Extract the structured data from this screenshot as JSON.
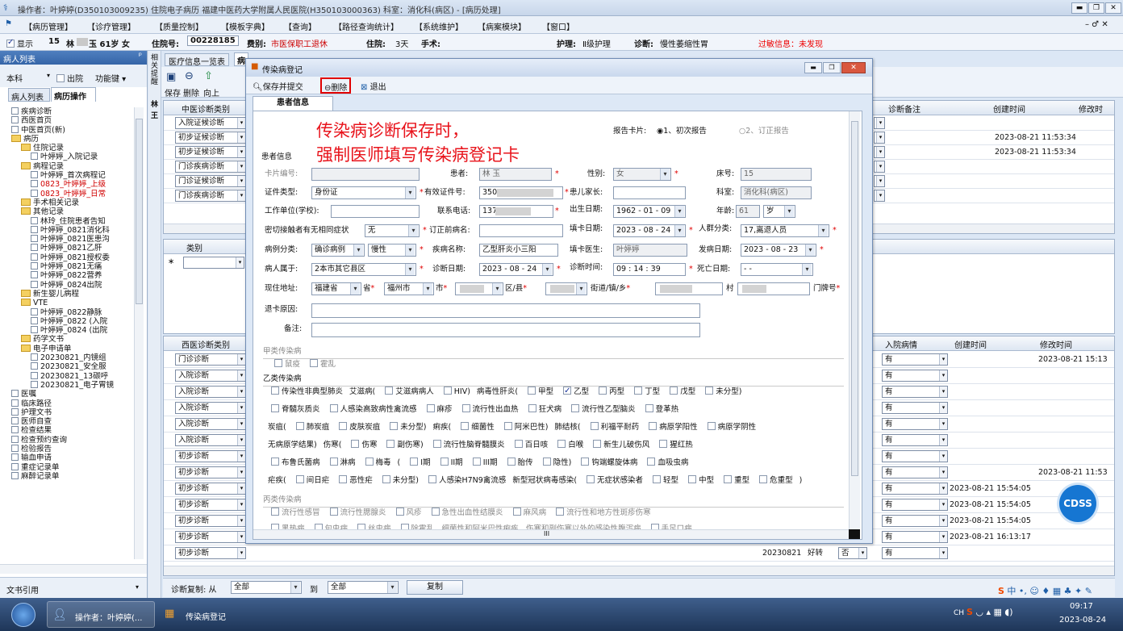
{
  "titlebar": {
    "text": "操作者：叶婷婷(D350103009235) 住院电子病历  福建中医药大学附属人民医院(H350103000363)  科室：消化科(病区) - [病历处理]"
  },
  "menu": [
    "【病历管理】",
    "【诊疗管理】",
    "【质量控制】",
    "【模板字典】",
    "【查询】",
    "【路径查询统计】",
    "【系统维护】",
    "【病案模块】",
    "【窗口】"
  ],
  "patient_bar": {
    "show": "显示",
    "bed": "15",
    "name": "林",
    "name2": "玉 61岁 女",
    "inpatient_no_label": "住院号:",
    "inpatient_no": "00228185",
    "category_label": "费别:",
    "category": "市医保职工退休",
    "days_label": "住院:",
    "days": "3天",
    "surgery_label": "手术:",
    "nursing_label": "护理:",
    "nursing": "Ⅱ级护理",
    "diagnosis_label": "诊断:",
    "diagnosis": "慢性萎缩性胃",
    "allergy": "过敏信息：未发现"
  },
  "left": {
    "header": "病人列表",
    "pin": "ᵖ",
    "dept": "本科",
    "discharged": "出院",
    "func": "功能键",
    "tab1": "病人列表",
    "tab2": "病历操作",
    "tree": [
      "疾病诊断",
      "西医首页",
      "中医首页(新)",
      "病历",
      "住院记录",
      "叶婷婷_入院记录",
      "病程记录",
      "叶婷婷_首次病程记",
      "0823_叶婷婷_上级",
      "0823_叶婷婷_日常",
      "手术相关记录",
      "其他记录",
      "林玲_住院患者告知",
      "叶婷婷_0821消化科",
      "叶婷婷_0821医患沟",
      "叶婷婷_0821乙肝",
      "叶婷婷_0821授权委",
      "叶婷婷_0821无痛",
      "叶婷婷_0822营养",
      "叶婷婷_0824出院",
      "新生婴儿病程",
      "VTE",
      "叶婷婷_0822静脉",
      "叶婷婷_0822 (入院",
      "叶婷婷_0824 (出院",
      "药学文书",
      "电子申请单",
      "20230821_内镜组",
      "20230821_安全服",
      "20230821_13碳呼",
      "20230821_电子胃镜",
      "医嘱",
      "临床路径",
      "护理文书",
      "医师自查",
      "检查结果",
      "检查预约查询",
      "检验报告",
      "输血申请",
      "重症记录单",
      "麻醉记录单"
    ],
    "bottom": "文书引用"
  },
  "side_strip": [
    "相关提醒",
    "林",
    "王"
  ],
  "tabs": {
    "t1": "医疗信息一览表",
    "t2": "病"
  },
  "toolbar": {
    "save": "保存",
    "delete": "删除",
    "up": "向上"
  },
  "upper_grid": {
    "col1": "中医诊断类别",
    "rows": [
      "入院证候诊断",
      "初步证候诊断",
      "初步证候诊断",
      "门诊疾病诊断",
      "门诊证候诊断",
      "门诊疾病诊断"
    ],
    "right_cols": [
      "诊断备注",
      "创建时间",
      "修改时"
    ],
    "times": [
      "",
      "2023-08-21 11:53:34",
      "2023-08-21 11:53:34",
      "",
      "",
      ""
    ]
  },
  "mid_grid": {
    "col": "类别",
    "star": "∗"
  },
  "lower_grid": {
    "col1": "西医诊断类别",
    "rows": [
      "门诊诊断",
      "入院诊断",
      "入院诊断",
      "入院诊断",
      "入院诊断",
      "入院诊断",
      "初步诊断",
      "初步诊断",
      "初步诊断",
      "初步诊断",
      "初步诊断",
      "初步诊断",
      "初步诊断"
    ],
    "right_cols": [
      "入院病情",
      "创建时间",
      "修改时间"
    ],
    "cond": "有",
    "created": [
      "",
      "",
      "",
      "",
      "",
      "",
      "",
      "",
      "2023-08-21 15:54:05",
      "2023-08-21 15:54:05",
      "2023-08-21 15:54:05",
      "2023-08-21 16:13:17",
      ""
    ],
    "modified": [
      "2023-08-21 15:13",
      "",
      "",
      "",
      "",
      "",
      "",
      "2023-08-21 11:53",
      "",
      "",
      "",
      "",
      ""
    ],
    "last_row": {
      "date": "20230821",
      "outcome": "好转",
      "flag": "否",
      "cond": "有"
    }
  },
  "bottom_bar": {
    "copy_label": "诊断复制: 从",
    "from": "全部",
    "to_label": "到",
    "to": "全部",
    "copy_btn": "复制"
  },
  "dialog": {
    "title": "传染病登记",
    "save_submit": "保存并提交",
    "delete": "删除",
    "exit": "退出",
    "tab": "患者信息",
    "annotation1": "传染病诊断保存时，",
    "annotation2": "强制医师填写传染病登记卡",
    "report_card_label": "报告卡片:",
    "report1": "1、初次报告",
    "report2": "2、订正报告",
    "section": "患者信息",
    "card_no_label": "卡片编号:",
    "patient_label": "患者:",
    "patient": "林  玉",
    "gender_label": "性别:",
    "gender": "女",
    "bed_label": "床号:",
    "bed": "15",
    "idtype_label": "证件类型:",
    "idtype": "身份证",
    "idno_label": "有效证件号:",
    "idno": "350",
    "guardian_label": "患儿家长:",
    "dept_label": "科室:",
    "dept": "消化科(病区)",
    "work_label": "工作单位(学校):",
    "phone_label": "联系电话:",
    "phone": "137",
    "dob_label": "出生日期:",
    "dob": "1962 - 01 - 09",
    "age_label": "年龄:",
    "age": "61",
    "age_unit": "岁",
    "contact_label": "密切接触者有无相同症状",
    "contact": "无",
    "prev_label": "订正前病名:",
    "fill_date_label": "填卡日期:",
    "fill_date": "2023 - 08 - 24",
    "crowd_label": "人群分类:",
    "crowd": "17,离退人员",
    "case_label": "病例分类:",
    "case1": "确诊病例",
    "case2": "慢性",
    "disease_label": "疾病名称:",
    "disease": "乙型肝炎小三阳",
    "doctor_label": "填卡医生:",
    "doctor": "叶婷婷",
    "onset_label": "发病日期:",
    "onset": "2023 - 08 - 23",
    "belong_label": "病人属于:",
    "belong": "2本市其它县区",
    "diag_date_label": "诊断日期:",
    "diag_date": "2023 - 08 - 24",
    "diag_time_label": "诊断时间:",
    "diag_time": "09 : 14 : 39",
    "death_label": "死亡日期:",
    "death": "-   -",
    "addr_label": "现住地址:",
    "province": "福建省",
    "province_s": "省",
    "city": "福州市",
    "city_s": "市",
    "district_s": "区/县",
    "street_s": "街道/镇/乡",
    "village_s": "村",
    "house_s": "门牌号",
    "return_label": "退卡原因:",
    "remark_label": "备注:",
    "classA": "甲类传染病",
    "classA_items": [
      "鼠疫",
      "霍乱"
    ],
    "classB": "乙类传染病",
    "b_line1": [
      "传染性非典型肺炎",
      "艾滋病(",
      "艾滋病病人",
      "HIV)",
      "病毒性肝炎(",
      "甲型",
      "乙型",
      "丙型",
      "丁型",
      "戊型",
      "未分型)"
    ],
    "b_line2": [
      "脊髓灰质炎",
      "人感染高致病性禽流感",
      "麻疹",
      "流行性出血热",
      "狂犬病",
      "流行性乙型脑炎",
      "登革热"
    ],
    "b_line3": [
      "炭疽(",
      "肺炭疽",
      "皮肤炭疽",
      "未分型)",
      "痢疾(",
      "细菌性",
      "阿米巴性)",
      "肺结核(",
      "利福平耐药",
      "病原学阳性",
      "病原学阴性"
    ],
    "b_line4": [
      "无病原学结果)",
      "伤寒(",
      "伤寒",
      "副伤寒)",
      "流行性脑脊髓膜炎",
      "百日咳",
      "白喉",
      "新生儿破伤风",
      "猩红热"
    ],
    "b_line5": [
      "布鲁氏菌病",
      "淋病",
      "梅毒",
      "(",
      "I期",
      "II期",
      "III期",
      "胎传",
      "隐性)",
      "钩端螺旋体病",
      "血吸虫病"
    ],
    "b_line6": [
      "疟疾(",
      "间日疟",
      "恶性疟",
      "未分型)",
      "人感染H7N9禽流感",
      "新型冠状病毒感染(",
      "无症状感染者",
      "轻型",
      "中型",
      "重型",
      "危重型",
      ")"
    ],
    "classC": "丙类传染病",
    "c_line1": [
      "流行性感冒",
      "流行性腮腺炎",
      "风疹",
      "急性出血性结膜炎",
      "麻风病",
      "流行性和地方性斑疹伤寒"
    ],
    "c_line2": [
      "黑热病",
      "包虫病",
      "丝虫病",
      "除霍乱、细菌性和阿米巴性痢疾、伤寒和副伤寒以外的感染性腹泻病",
      "手足口病"
    ],
    "scroll_mark": "III"
  },
  "cdss": "CDSS",
  "taskbar": {
    "item1": "操作者：叶婷婷(...",
    "item2": "传染病登记",
    "time": "09:17",
    "date": "2023-08-24",
    "lang": "CH"
  },
  "colors": {
    "annotation": "#e8131b",
    "highlight": "#e00000",
    "accent": "#1f5fa8"
  }
}
